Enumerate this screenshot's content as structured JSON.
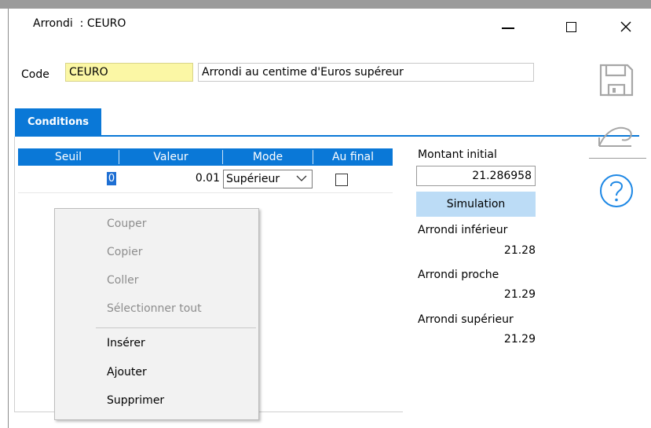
{
  "window": {
    "title": "Arrondi  : CEURO"
  },
  "code": {
    "label": "Code",
    "value": "CEURO",
    "description": "Arrondi au centime d'Euros supéreur"
  },
  "tabs": [
    {
      "label": "Conditions",
      "active": true
    }
  ],
  "grid": {
    "columns": [
      "Seuil",
      "Valeur",
      "Mode",
      "Au final"
    ],
    "rows": [
      {
        "seuil": "0",
        "valeur": "0.01",
        "mode": "Supérieur",
        "au_final": false
      }
    ]
  },
  "simulation": {
    "montant_label": "Montant initial",
    "montant_value": "21.286958",
    "button_label": "Simulation",
    "inferieur_label": "Arrondi inférieur",
    "inferieur_value": "21.28",
    "proche_label": "Arrondi proche",
    "proche_value": "21.29",
    "superieur_label": "Arrondi supérieur",
    "superieur_value": "21.29"
  },
  "context_menu": {
    "items_disabled": [
      "Couper",
      "Copier",
      "Coller",
      "Sélectionner tout"
    ],
    "items_enabled": [
      "Insérer",
      "Ajouter",
      "Supprimer"
    ]
  },
  "toolbar": {
    "icons": [
      "save-icon",
      "undo-icon",
      "help-icon"
    ]
  },
  "colors": {
    "accent": "#0a78d7",
    "code_field": "#fbf7a5",
    "simulation_button": "#bcdcf6"
  }
}
